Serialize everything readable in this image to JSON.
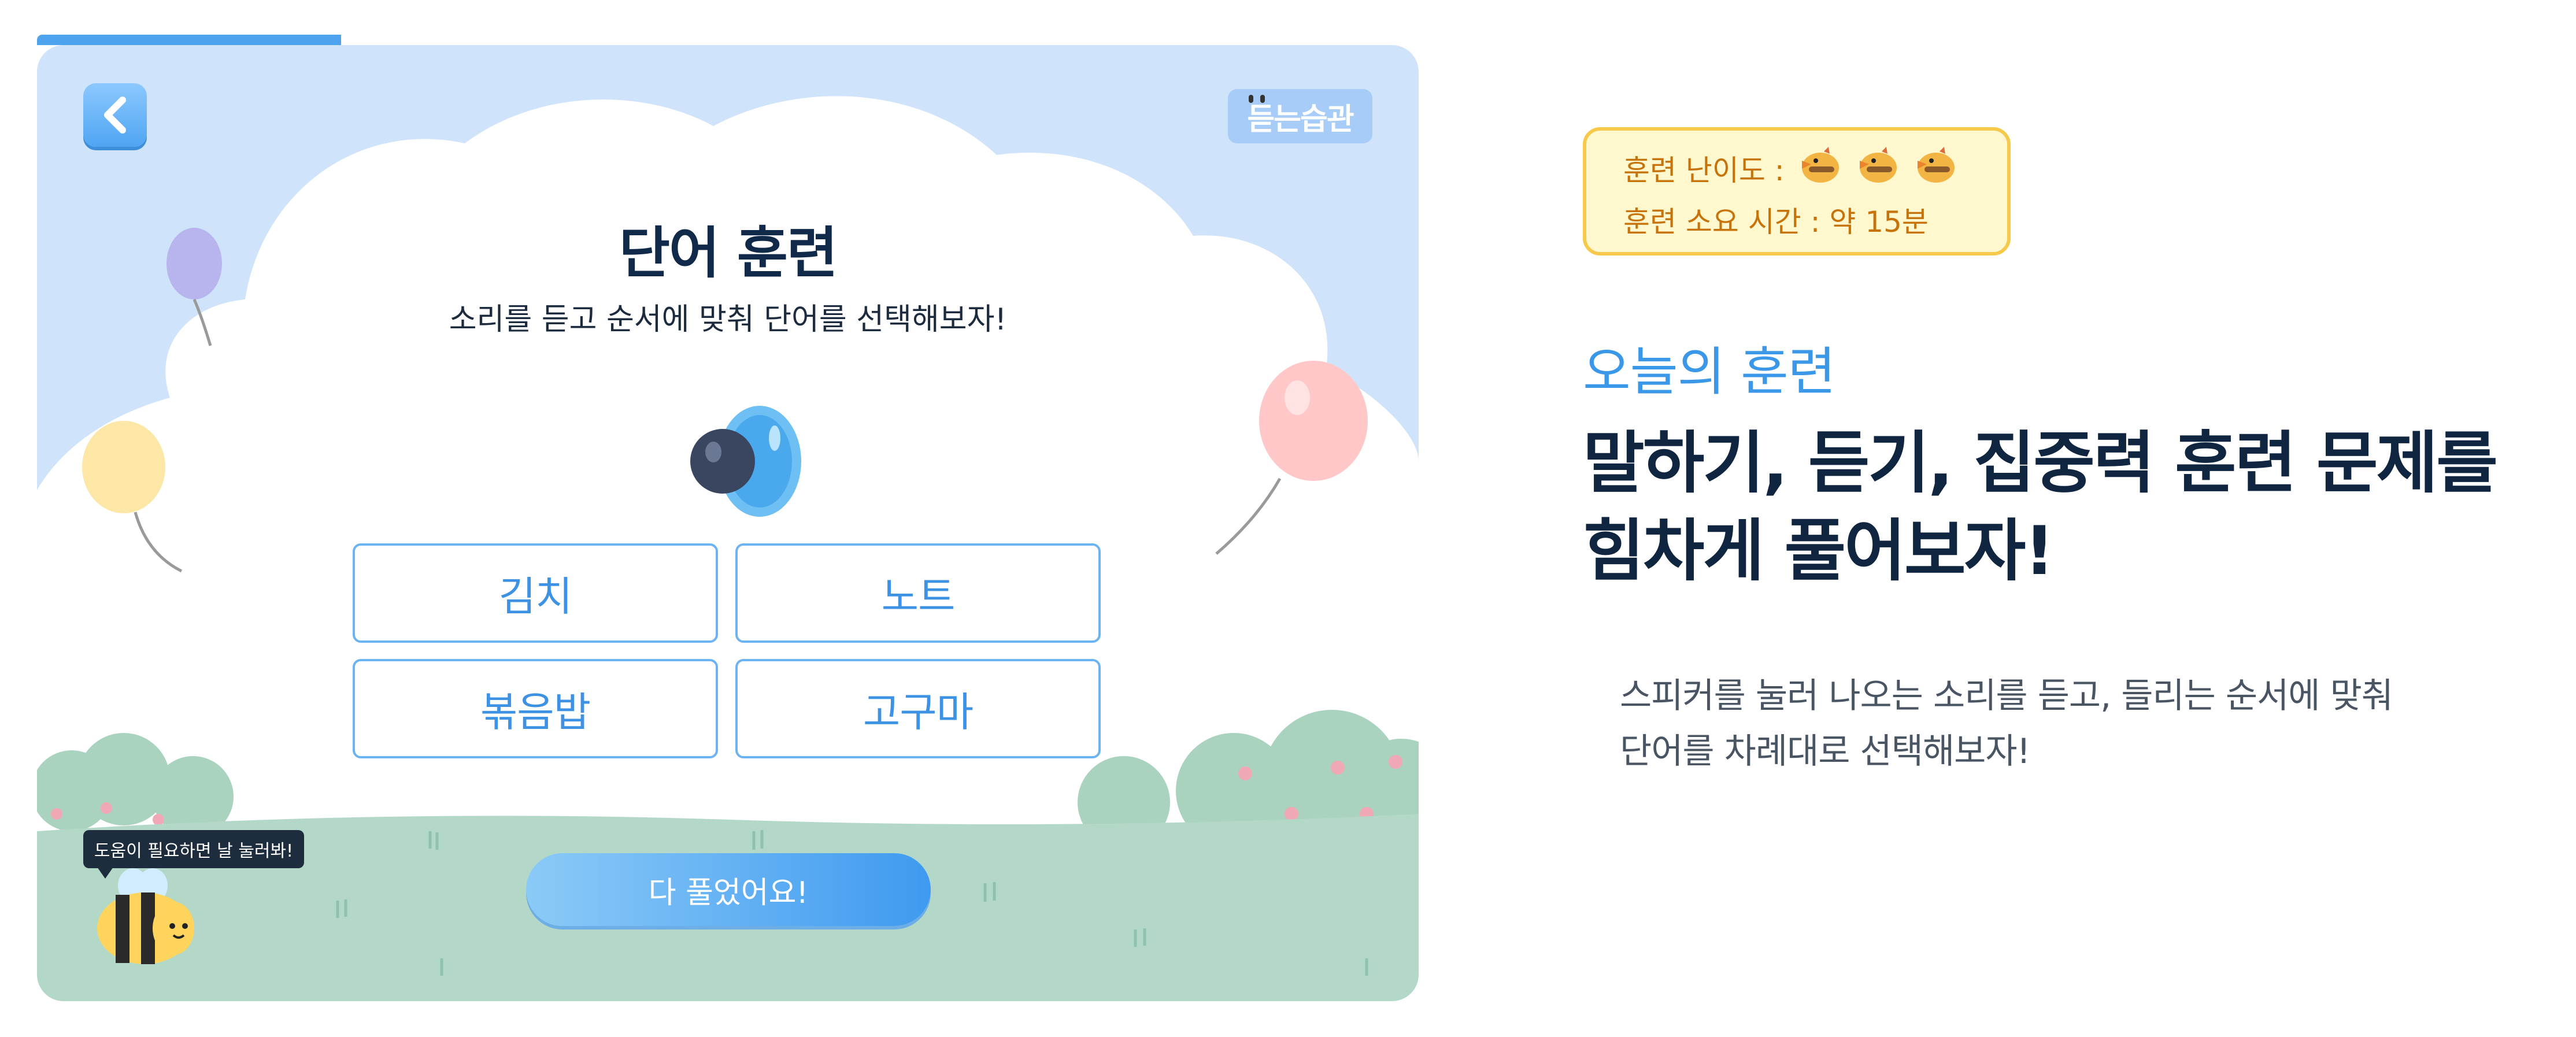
{
  "progress_fraction": 0.22,
  "topbar": {
    "back_icon": "chevron-left-icon",
    "logo_text": "듣는습관"
  },
  "training": {
    "title": "단어 훈련",
    "instruction": "소리를 듣고 순서에 맞춰 단어를 선택해보자!",
    "speaker_icon": "speaker-icon",
    "choices": [
      "김치",
      "노트",
      "볶음밥",
      "고구마"
    ],
    "done_label": "다 풀었어요!",
    "help_tooltip": "도움이 필요하면 날 눌러봐!"
  },
  "info": {
    "difficulty_label": "훈련 난이도 :",
    "difficulty_level": 3,
    "difficulty_max": 3,
    "time_label": "훈련 소요 시간 : 약 15분"
  },
  "panel": {
    "section_label": "오늘의 훈련",
    "headline_line1": "말하기, 듣기, 집중력 훈련 문제를",
    "headline_line2": "힘차게 풀어보자!",
    "description_line1": "스피커를 눌러 나오는 소리를 듣고, 들리는 순서에 맞춰",
    "description_line2": "단어를 차례대로 선택해보자!"
  },
  "colors": {
    "accent": "#3b98e9",
    "sky": "#cfe3fb",
    "grass": "#b3d8c8",
    "info_border": "#f7c94a",
    "info_text": "#c7730a"
  }
}
